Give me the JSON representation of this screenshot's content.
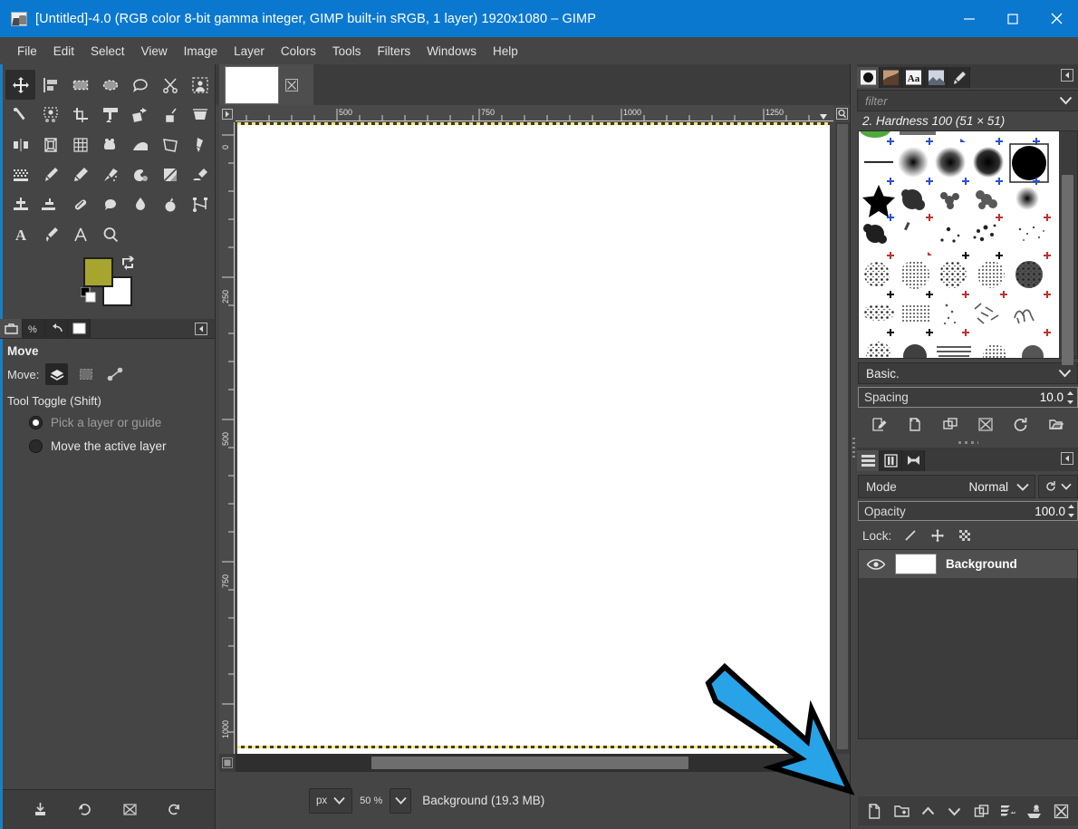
{
  "window": {
    "title": "[Untitled]-4.0 (RGB color 8-bit gamma integer, GIMP built-in sRGB, 1 layer) 1920x1080 – GIMP",
    "app_icon": "gimp-wilber-icon",
    "minimize": "minimize-icon",
    "maximize": "maximize-icon",
    "close": "close-icon",
    "titlebar_color": "#0b78d0"
  },
  "menubar": {
    "items": [
      {
        "label": "File"
      },
      {
        "label": "Edit"
      },
      {
        "label": "Select"
      },
      {
        "label": "View"
      },
      {
        "label": "Image"
      },
      {
        "label": "Layer"
      },
      {
        "label": "Colors"
      },
      {
        "label": "Tools"
      },
      {
        "label": "Filters"
      },
      {
        "label": "Windows"
      },
      {
        "label": "Help"
      }
    ]
  },
  "toolbox": {
    "tools": [
      {
        "name": "move-tool",
        "active": true
      },
      {
        "name": "alignment-tool",
        "active": false
      },
      {
        "name": "rectangle-select-tool",
        "active": false
      },
      {
        "name": "ellipse-select-tool",
        "active": false
      },
      {
        "name": "free-select-tool",
        "active": false
      },
      {
        "name": "scissors-select-tool",
        "active": false
      },
      {
        "name": "foreground-select-tool",
        "active": false
      },
      {
        "name": "fuzzy-select-tool",
        "active": false
      },
      {
        "name": "select-by-color-tool",
        "active": false
      },
      {
        "name": "crop-tool",
        "active": false
      },
      {
        "name": "transform-tool",
        "active": false
      },
      {
        "name": "rotate-tool",
        "active": false
      },
      {
        "name": "shear-tool",
        "active": false
      },
      {
        "name": "perspective-tool",
        "active": false
      },
      {
        "name": "flip-tool",
        "active": false
      },
      {
        "name": "cage-transform-tool",
        "active": false
      },
      {
        "name": "warp-transform-tool",
        "active": false
      },
      {
        "name": "bucket-fill-tool",
        "active": false
      },
      {
        "name": "gradient-tool",
        "active": false
      },
      {
        "name": "handle-transform-tool",
        "active": false
      },
      {
        "name": "ink-tool",
        "active": false
      },
      {
        "name": "dither-tool",
        "active": false
      },
      {
        "name": "paintbrush-tool",
        "active": false
      },
      {
        "name": "pencil-tool",
        "active": false
      },
      {
        "name": "airbrush-tool",
        "active": false
      },
      {
        "name": "mypaint-brush-tool",
        "active": false
      },
      {
        "name": "eraser-tool",
        "active": false
      },
      {
        "name": "eraser-alt-tool",
        "active": false
      },
      {
        "name": "clone-tool",
        "active": false
      },
      {
        "name": "perspective-clone-tool",
        "active": false
      },
      {
        "name": "heal-tool",
        "active": false
      },
      {
        "name": "smudge-tool",
        "active": false
      },
      {
        "name": "blur-sharpen-tool",
        "active": false
      },
      {
        "name": "dodge-burn-tool",
        "active": false
      },
      {
        "name": "paths-tool",
        "active": false
      },
      {
        "name": "text-tool",
        "active": false
      },
      {
        "name": "color-picker-tool",
        "active": false
      },
      {
        "name": "measure-tool",
        "active": false
      },
      {
        "name": "zoom-tool",
        "active": false
      }
    ],
    "colors": {
      "foreground": "#a8a52e",
      "background": "#ffffff",
      "swap_icon": "swap-colors-icon",
      "default_icon": "default-colors-icon"
    },
    "bottom_buttons": [
      {
        "name": "save-tool-options-button",
        "icon": "save-icon"
      },
      {
        "name": "restore-tool-options-button",
        "icon": "undo-icon"
      },
      {
        "name": "delete-tool-options-button",
        "icon": "delete-icon"
      },
      {
        "name": "reset-tool-options-button",
        "icon": "reset-icon"
      }
    ]
  },
  "tool_options": {
    "tabs": [
      {
        "name": "tool-options-tab",
        "icon": "toolbox-icon",
        "active": true
      },
      {
        "name": "device-status-tab",
        "icon": "device-icon",
        "active": false
      },
      {
        "name": "undo-history-tab",
        "icon": "undo-history-icon",
        "active": false
      },
      {
        "name": "images-tab",
        "icon": "image-icon",
        "active": false
      }
    ],
    "collapse_icon": "collapse-arrow-icon",
    "title": "Move",
    "move_label": "Move:",
    "move_modes": [
      {
        "name": "move-layer-mode",
        "icon": "layer-icon",
        "selected": true
      },
      {
        "name": "move-selection-mode",
        "icon": "selection-icon",
        "selected": false
      },
      {
        "name": "move-path-mode",
        "icon": "path-icon",
        "selected": false
      }
    ],
    "toggle_section": "Tool Toggle  (Shift)",
    "radios": [
      {
        "label": "Pick a layer or guide",
        "selected": true
      },
      {
        "label": "Move the active layer",
        "selected": false
      }
    ]
  },
  "image_window": {
    "tab_thumbnail": "image-thumbnail",
    "tab_close_icon": "close-tab-icon",
    "h_ruler": {
      "ticks": [
        "500",
        "750",
        "1000",
        "1250"
      ]
    },
    "v_ruler": {
      "ticks": [
        "0",
        "250",
        "500",
        "750",
        "1000"
      ]
    },
    "ruler_menu_icon": "ruler-menu-icon",
    "zoom_image_icon": "zoom-image-icon",
    "nav_icon": "navigation-icon",
    "statusbar": {
      "unit": "px",
      "zoom": "50 %",
      "status": "Background (19.3 MB)"
    }
  },
  "brushes_dock": {
    "tabs": [
      {
        "name": "brushes-tab",
        "icon": "brush-circle-icon",
        "active": true
      },
      {
        "name": "patterns-tab",
        "icon": "pattern-icon",
        "active": false
      },
      {
        "name": "fonts-tab",
        "icon": "font-aa-icon",
        "active": false
      },
      {
        "name": "images-tab",
        "icon": "image-icon",
        "active": false
      },
      {
        "name": "paint-dynamics-tab",
        "icon": "paintbrush-icon",
        "active": false
      }
    ],
    "collapse_icon": "collapse-arrow-icon",
    "filter_placeholder": "filter",
    "filter_dropdown_icon": "chevron-down-icon",
    "selected_brush": "2. Hardness 100 (51 × 51)",
    "tag_combo": "Basic.",
    "tag_dropdown_icon": "chevron-down-icon",
    "spacing_label": "Spacing",
    "spacing_value": "10.0",
    "spinner_icon": "spinner-icon",
    "buttons": [
      {
        "name": "edit-brush-button",
        "icon": "edit-icon"
      },
      {
        "name": "new-brush-button",
        "icon": "new-icon"
      },
      {
        "name": "duplicate-brush-button",
        "icon": "duplicate-icon"
      },
      {
        "name": "delete-brush-button",
        "icon": "delete-x-icon"
      },
      {
        "name": "refresh-brushes-button",
        "icon": "refresh-icon"
      },
      {
        "name": "open-brush-as-image-button",
        "icon": "open-image-icon"
      }
    ]
  },
  "layers_dock": {
    "tabs": [
      {
        "name": "layers-tab",
        "icon": "layers-icon",
        "active": true
      },
      {
        "name": "channels-tab",
        "icon": "channels-icon",
        "active": false
      },
      {
        "name": "paths-tab",
        "icon": "paths-icon",
        "active": false
      }
    ],
    "collapse_icon": "collapse-arrow-icon",
    "mode_label": "Mode",
    "mode_value": "Normal",
    "mode_dropdown_icon": "chevron-down-icon",
    "mode_extra_icon": "blend-space-icon",
    "opacity_label": "Opacity",
    "opacity_value": "100.0",
    "lock_label": "Lock:",
    "lock_buttons": [
      {
        "name": "lock-pixels-button",
        "icon": "brush-stroke-icon"
      },
      {
        "name": "lock-position-button",
        "icon": "move-cross-icon"
      },
      {
        "name": "lock-alpha-button",
        "icon": "checker-alpha-icon"
      }
    ],
    "layers": [
      {
        "name": "Background",
        "visible": true,
        "thumbnail": "white-thumbnail"
      }
    ],
    "eye_icon": "eye-visible-icon",
    "buttons": [
      {
        "name": "new-layer-button",
        "icon": "new-layer-icon"
      },
      {
        "name": "new-layer-group-button",
        "icon": "new-group-icon"
      },
      {
        "name": "raise-layer-button",
        "icon": "chevron-up-icon"
      },
      {
        "name": "lower-layer-button",
        "icon": "chevron-down-icon"
      },
      {
        "name": "duplicate-layer-button",
        "icon": "duplicate-layer-icon"
      },
      {
        "name": "anchor-layer-button",
        "icon": "merge-down-icon"
      },
      {
        "name": "merge-layer-button",
        "icon": "anchor-icon"
      },
      {
        "name": "delete-layer-button",
        "icon": "delete-layer-icon"
      }
    ]
  },
  "annotation": {
    "arrow": "blue-pointer-arrow",
    "arrow_fill": "#29a3e8",
    "arrow_stroke": "#000000"
  }
}
